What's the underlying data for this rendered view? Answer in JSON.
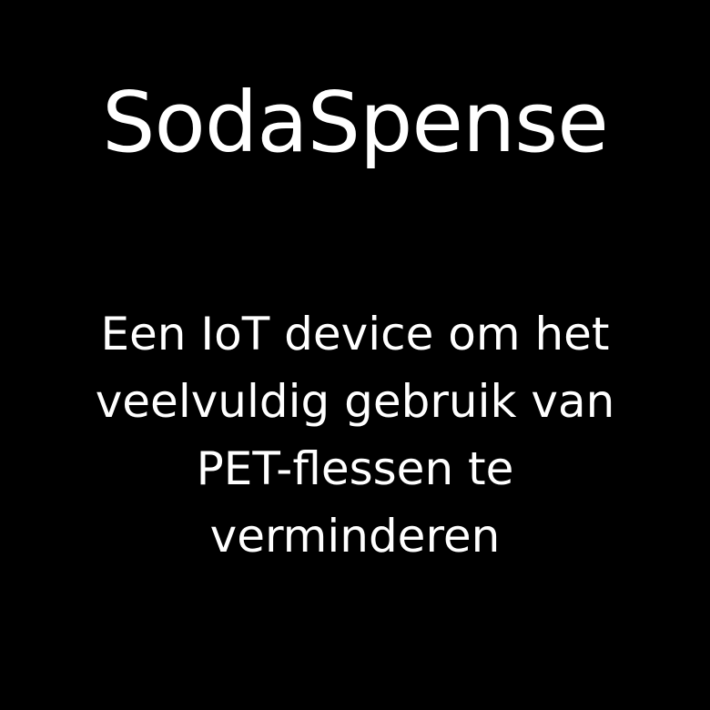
{
  "title": "SodaSpense",
  "tagline": {
    "lines": [
      "Een IoT device om het",
      "veelvuldig gebruik van",
      "PET-flessen te",
      "verminderen"
    ]
  },
  "colors": {
    "background": "#000000",
    "text": "#ffffff"
  }
}
